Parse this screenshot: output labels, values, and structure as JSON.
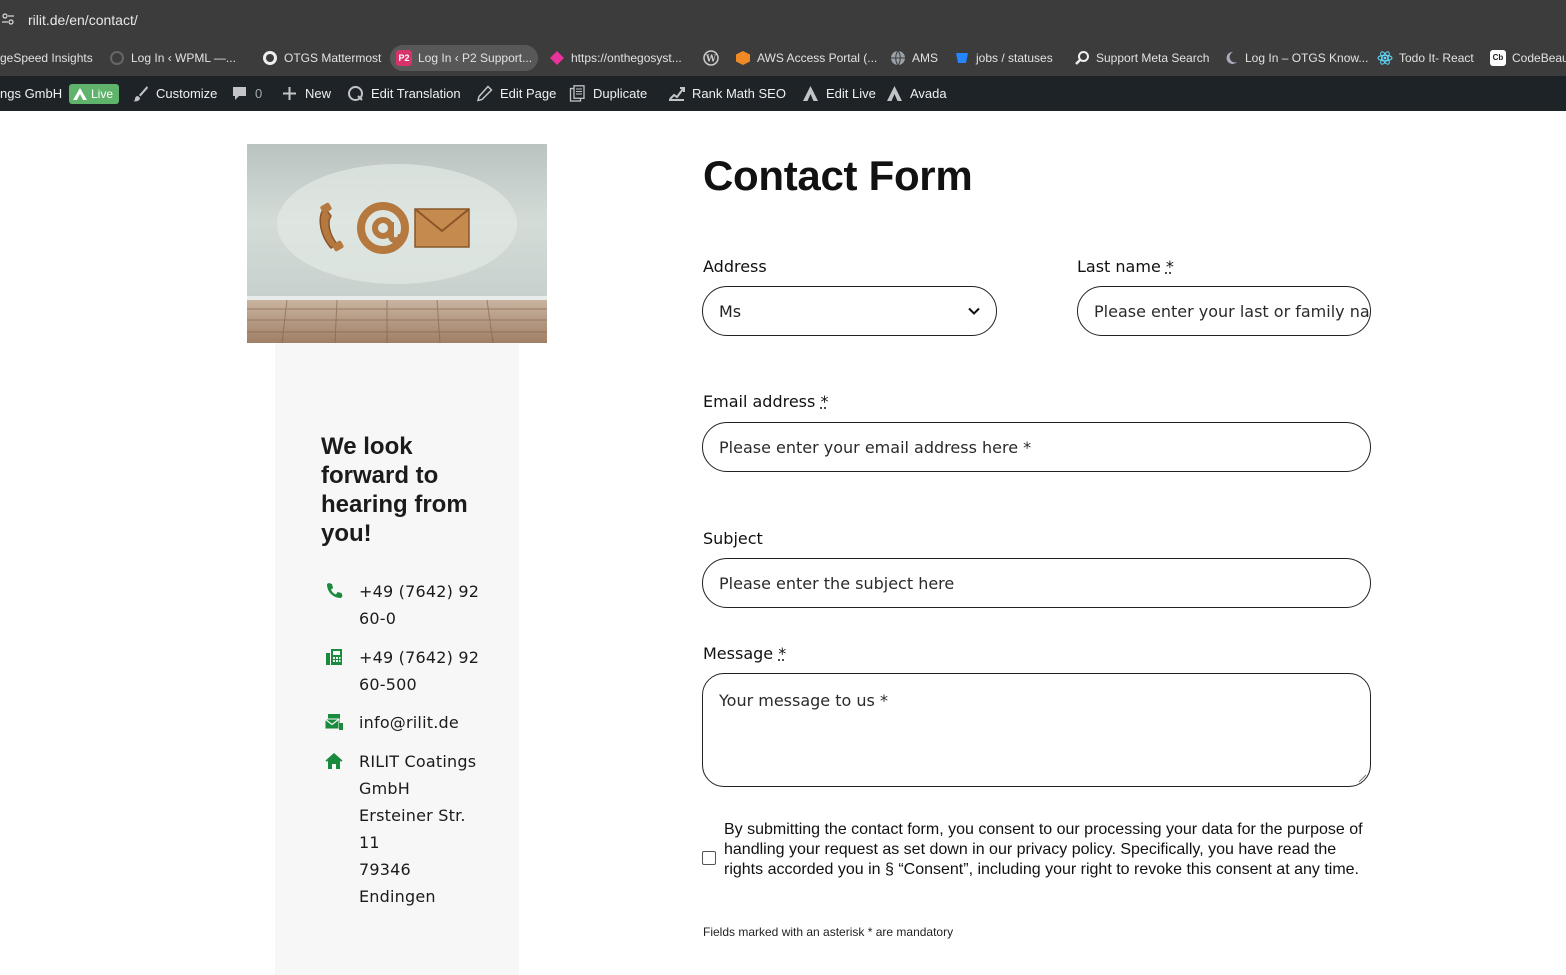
{
  "browser": {
    "url": "rilit.de/en/contact/",
    "bookmarks": [
      {
        "label": "geSpeed Insights",
        "icon": "pagespeed-icon"
      },
      {
        "label": "Log In ‹ WPML —...",
        "icon": "wpml-icon"
      },
      {
        "label": "OTGS Mattermost",
        "icon": "mattermost-icon"
      },
      {
        "label": "Log In ‹ P2 Support...",
        "icon": "p2-icon"
      },
      {
        "label": "https://onthegosyst...",
        "icon": "pink-diamond-icon"
      },
      {
        "label": "",
        "icon": "wordpress-icon"
      },
      {
        "label": "AWS Access Portal (...",
        "icon": "aws-cube-icon"
      },
      {
        "label": "AMS",
        "icon": "globe-icon"
      },
      {
        "label": "jobs / statuses",
        "icon": "bitbucket-icon"
      },
      {
        "label": "Support Meta Search",
        "icon": "magnifier-icon"
      },
      {
        "label": "Log In – OTGS Know...",
        "icon": "moon-icon"
      },
      {
        "label": "Todo It- React",
        "icon": "react-icon"
      },
      {
        "label": "CodeBeau",
        "icon": "codebeautify-icon"
      }
    ]
  },
  "admin_bar": {
    "site_name": "ngs GmbH",
    "live_label": "Live",
    "customize": "Customize",
    "comments_count": "0",
    "new": "New",
    "edit_translation": "Edit Translation",
    "edit_page": "Edit Page",
    "duplicate": "Duplicate",
    "rank_math": "Rank Math SEO",
    "edit_live": "Edit Live",
    "avada": "Avada"
  },
  "sidebar": {
    "heading": "We look forward to hearing from you!",
    "phone": "+49 (7642) 92 60-0",
    "fax": "+49 (7642) 92 60-500",
    "email": "info@rilit.de",
    "address": "RILIT Coatings GmbH\nErsteiner Str. 11\n79346 Endingen"
  },
  "form": {
    "title": "Contact Form",
    "address_label": "Address",
    "address_value": "Ms",
    "lastname_label": "Last name",
    "lastname_placeholder": "Please enter your last or family name *",
    "email_label": "Email address",
    "email_placeholder": "Please enter your email address here *",
    "subject_label": "Subject",
    "subject_placeholder": "Please enter the subject here",
    "message_label": "Message",
    "message_placeholder": "Your message to us *",
    "required_marker": "*",
    "consent_text": "By submitting the contact form, you consent to our processing your data for the purpose of handling your request as set down in our privacy policy. Specifically, you have read the rights accorded you in § “Consent”, including your right to revoke this consent at any time.",
    "mandatory_note": "Fields marked with an asterisk * are mandatory"
  },
  "colors": {
    "accent_green": "#1a8a3c",
    "admin_bar_bg": "#1d2327",
    "chrome_bg": "#3c3c3c"
  }
}
